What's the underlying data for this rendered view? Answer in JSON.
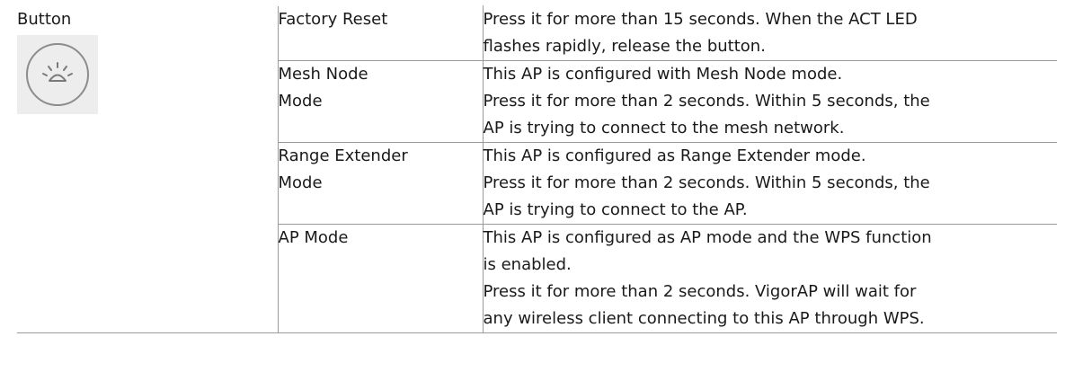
{
  "table": {
    "item_name": "Button",
    "item_icon": "wps-button-icon",
    "rows": [
      {
        "mode": "Factory Reset",
        "description": [
          "Press it for more than 15 seconds. When the ACT LED",
          "flashes rapidly, release the button."
        ]
      },
      {
        "mode": "Mesh Node Mode",
        "description": [
          "This AP is configured with Mesh Node mode.",
          "Press it for more than 2 seconds. Within 5 seconds, the",
          "AP is trying to connect to the mesh network."
        ]
      },
      {
        "mode": "Range Extender Mode",
        "description": [
          "This AP is configured as Range Extender mode.",
          "Press it for more than 2 seconds. Within 5 seconds, the",
          "AP is trying to connect to the AP."
        ]
      },
      {
        "mode": "AP Mode",
        "description": [
          "This AP is configured as AP mode and the WPS function",
          "is enabled.",
          "Press it for more than 2 seconds. VigorAP will wait for",
          "any wireless client connecting to this AP through WPS."
        ]
      }
    ]
  }
}
